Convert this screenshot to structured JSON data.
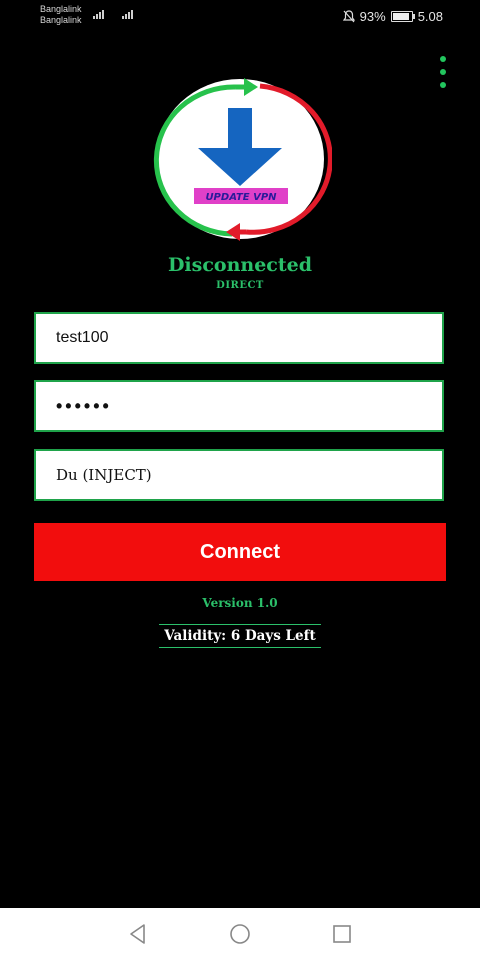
{
  "status_bar": {
    "carrier_1": "Banglalink",
    "carrier_2": "Banglalink",
    "battery_percent": "93%",
    "battery_level": 0.93,
    "time": "5.08",
    "icons": [
      "signal-icon",
      "mute-icon",
      "battery-icon"
    ]
  },
  "app": {
    "logo_text": "UPDATE VPN",
    "status": "Disconnected",
    "mode": "DIRECT",
    "username": "test100",
    "password_mask": "••••••",
    "server": "Du (INJECT)",
    "connect_label": "Connect",
    "version": "Version  1.0",
    "validity": "Validity: 6 Days Left"
  },
  "colors": {
    "accent_green": "#2bc06a",
    "connect_red": "#f20d0d",
    "background": "#000000"
  },
  "nav": {
    "icons": [
      "back-icon",
      "home-icon",
      "recents-icon"
    ]
  }
}
